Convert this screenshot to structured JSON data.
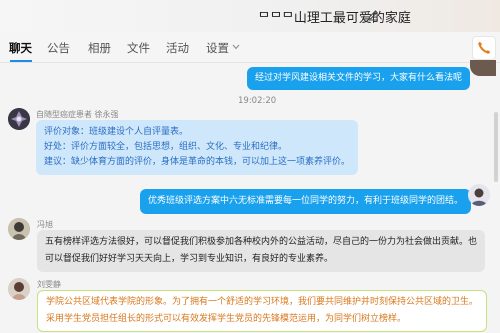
{
  "window": {
    "title": "ᄆᄆᄆ山理工最可爱的家庭"
  },
  "tabs": [
    {
      "label": "聊天",
      "active": true
    },
    {
      "label": "公告"
    },
    {
      "label": "相册"
    },
    {
      "label": "文件"
    },
    {
      "label": "活动"
    },
    {
      "label": "设置"
    }
  ],
  "icons": {
    "edit": "pencil-icon",
    "settings_dropdown": "chevron-down-icon",
    "phone": "phone-icon"
  },
  "messages": [
    {
      "side": "right",
      "lines": [
        "经过对学风建设相关文件的学习，大家有什么看法呢"
      ]
    },
    {
      "timestamp": "19:02:20"
    },
    {
      "side": "left",
      "sender": "自随型癌症患者 徐永强",
      "lines": [
        "评价对象：班级建设个人自评量表。",
        "好处：评价方面较全，包括思想，组织、文化、专业和纪律。",
        "建议：缺少体育方面的评价，身体是革命的本钱，可以加上这一项素养评价。"
      ]
    },
    {
      "side": "right",
      "lines": [
        "优秀班级评选方案中六无标准需要每一位同学的努力，有利于班级同学的团结。"
      ]
    },
    {
      "side": "left",
      "sender": "冯旭",
      "lines": [
        "五有榜样评选方法很好，可以督促我们积极参加各种校内外的公益活动，尽自己的一份力为社会做出贡献。也",
        "可以督促我们好好学习天天向上，学习到专业知识，有良好的专业素养。"
      ]
    },
    {
      "side": "left",
      "sender": "刘雯静",
      "lines": [
        "学院公共区域代表学院的形象。为了拥有一个舒适的学习环境，我们要共同维护并时刻保持公共区域的卫生。",
        "采用学生党员担任组长的形式可以有效发挥学生党员的先锋模范运用，为同学们树立榜样。"
      ]
    }
  ],
  "colors": {
    "accent": "#1e8be6",
    "bubble_blue": "#1aa1ee",
    "bubble_light": "#cfe7fb",
    "bubble_gray": "#e5e5e5",
    "bubble_green_border": "#c6e27a",
    "bubble_green_text": "#d8781e"
  }
}
